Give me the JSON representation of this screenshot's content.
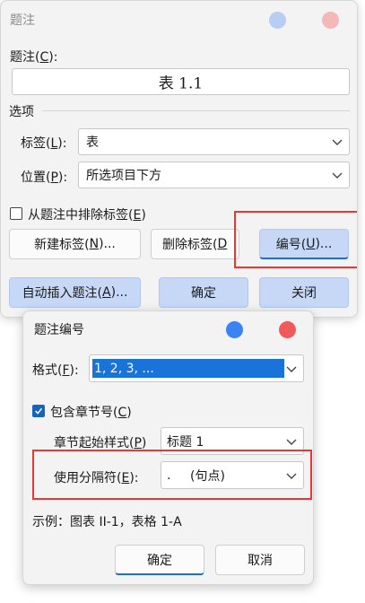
{
  "caption_dialog": {
    "title": "题注",
    "caption_label_pre": "题注(",
    "caption_label_key": "C",
    "caption_label_post": "):",
    "caption_value": "表  1.1",
    "options_label": "选项",
    "label_field_pre": "标签(",
    "label_field_key": "L",
    "label_field_post": "):",
    "label_value": "表",
    "position_field_pre": "位置(",
    "position_field_key": "P",
    "position_field_post": "):",
    "position_value": "所选项目下方",
    "exclude_label_pre": "从题注中排除标签(",
    "exclude_label_key": "E",
    "exclude_label_post": ")",
    "exclude_checked": false,
    "new_label_pre": "新建标签(",
    "new_label_key": "N",
    "new_label_post": ")...",
    "delete_label_pre": "删除标签(",
    "delete_label_key": "D",
    "numbering_pre": "编号(",
    "numbering_key": "U",
    "numbering_post": ")...",
    "autocaption_pre": "自动插入题注(",
    "autocaption_key": "A",
    "autocaption_post": ")...",
    "ok": "确定",
    "close": "关闭"
  },
  "numbering_dialog": {
    "title": "题注编号",
    "format_pre": "格式(",
    "format_key": "F",
    "format_post": "):",
    "format_value": "1, 2, 3, ...",
    "include_chapter_pre": "包含章节号(",
    "include_chapter_key": "C",
    "include_chapter_post": ")",
    "include_chapter_checked": true,
    "chapter_style_pre": "章节起始样式(",
    "chapter_style_key": "P",
    "chapter_style_post": ")",
    "chapter_style_value": "标题 1",
    "separator_pre": "使用分隔符(",
    "separator_key": "E",
    "separator_post": "):",
    "separator_char": ".",
    "separator_desc": "(句点)",
    "example": "示例：图表 II-1，表格 1-A",
    "ok": "确定",
    "cancel": "取消"
  },
  "colors": {
    "accent": "#1a6fd6",
    "highlight_box": "#e53935",
    "minimize_dot": "#b8cdf2",
    "close_dot_inactive": "#f4b8b8",
    "minimize_dot_active": "#3b82f6",
    "close_dot_active": "#f05a5a",
    "selection": "#1a73d9"
  }
}
